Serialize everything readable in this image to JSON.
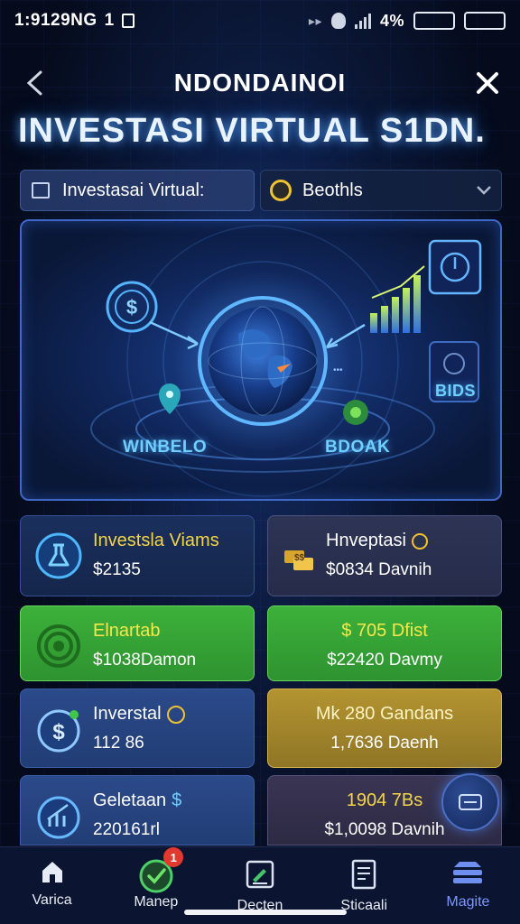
{
  "status_bar": {
    "time": "1:9129NG",
    "extra": "1",
    "network": "4%"
  },
  "header": {
    "title": "NDONDAINOI",
    "big_title": "INVESTASI VIRTUAL S1DN."
  },
  "selector": {
    "left_label": "Investasai Virtual:",
    "right_label": "Beothls"
  },
  "hero": {
    "label_left": "WINBELO",
    "label_right": "BDOAK",
    "label_side": "BIDS"
  },
  "cards": [
    {
      "title": "Investsla Viams",
      "value": "$2135",
      "title_color": "#f5d547"
    },
    {
      "title": "Hnveptasi",
      "value": "$0834 Davnih",
      "title_color": "#ffffff"
    },
    {
      "title": "Elnartab",
      "value": "$1038Damon",
      "title_color": "#f5e94a"
    },
    {
      "title": "$ 705 Dfist",
      "value": "$22420 Davmy",
      "title_color": "#f5e94a"
    },
    {
      "title": "Inverstal",
      "value": "112 86",
      "title_color": "#ffffff"
    },
    {
      "title": "Mk 280 Gandans",
      "value": "1,7636 Daenh",
      "title_color": "#fff3c2"
    },
    {
      "title": "Geletaan",
      "value": "220161rl",
      "title_color": "#ffffff"
    },
    {
      "title": "1904 7Bs",
      "value": "$1,0098 Davnih",
      "title_color": "#f5d547"
    }
  ],
  "bottom_nav": [
    {
      "label": "Varica",
      "icon": "home-icon"
    },
    {
      "label": "Manep",
      "icon": "check-circle-icon",
      "badge": "1"
    },
    {
      "label": "Decten",
      "icon": "edit-document-icon"
    },
    {
      "label": "Sticaali",
      "icon": "report-icon"
    },
    {
      "label": "Magite",
      "icon": "stack-icon"
    }
  ],
  "colors": {
    "accent": "#3f67c5",
    "active_nav": "#7a98ff",
    "green_card": "#3cb13a",
    "gold_card": "#b49431"
  }
}
